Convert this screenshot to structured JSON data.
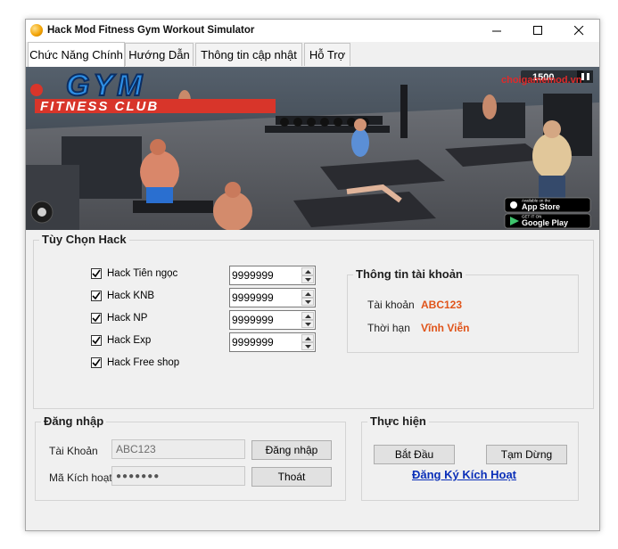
{
  "window": {
    "title": "Hack Mod Fitness Gym Workout Simulator"
  },
  "tabs": [
    {
      "label": "Chức Năng Chính",
      "active": true
    },
    {
      "label": "Hướng Dẫn",
      "active": false
    },
    {
      "label": "Thông tin cập nhật",
      "active": false
    },
    {
      "label": "Hỗ Trợ",
      "active": false
    }
  ],
  "banner": {
    "logo_main": "GYM",
    "logo_sub": "FITNESS CLUB",
    "score": "1500",
    "watermark": "choigamemod.vn",
    "app_store_small": "Available on the",
    "app_store": "App Store",
    "google_play_small": "GET IT ON",
    "google_play": "Google Play",
    "colors": {
      "logo_blue": "#2d8fe6",
      "logo_red": "#d8352a",
      "floor": "#5c5f66"
    }
  },
  "hack_options": {
    "title": "Tùy Chọn Hack",
    "items": [
      {
        "label": "Hack Tiên ngọc",
        "checked": true,
        "value": "9999999"
      },
      {
        "label": "Hack KNB",
        "checked": true,
        "value": "9999999"
      },
      {
        "label": "Hack NP",
        "checked": true,
        "value": "9999999"
      },
      {
        "label": "Hack Exp",
        "checked": true,
        "value": "9999999"
      },
      {
        "label": "Hack Free shop",
        "checked": true
      }
    ]
  },
  "account_info": {
    "title": "Thông tin tài khoản",
    "account_label": "Tài khoản",
    "account_value": "ABC123",
    "duration_label": "Thời hạn",
    "duration_value": "Vĩnh Viễn",
    "value_color": "#e0541a"
  },
  "login": {
    "title": "Đăng nhập",
    "account_label": "Tài Khoản",
    "account_value": "ABC123",
    "code_label": "Mã Kích hoạt",
    "code_value": "●●●●●●●",
    "login_button": "Đăng nhập",
    "exit_button": "Thoát"
  },
  "action": {
    "title": "Thực hiện",
    "start_button": "Bắt Đầu",
    "pause_button": "Tạm Dừng",
    "register_link": "Đăng Ký Kích Hoạt",
    "link_color": "#0a2fb8"
  }
}
